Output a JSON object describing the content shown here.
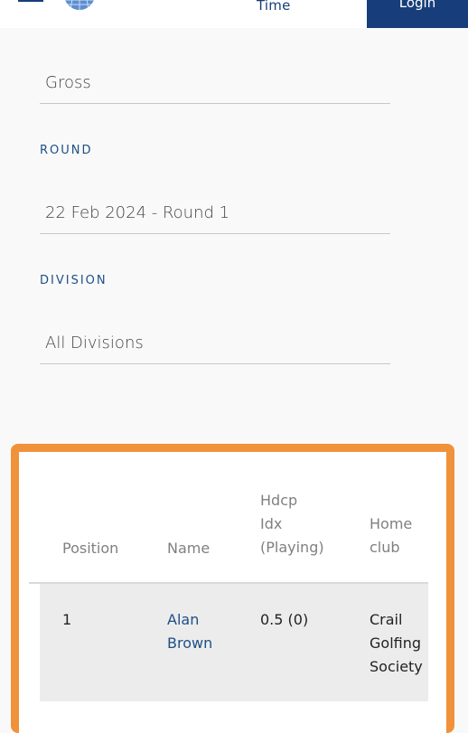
{
  "header": {
    "nav_link": "Time",
    "login_label": "Login"
  },
  "filters": {
    "score_type": {
      "value": "Gross"
    },
    "round": {
      "label": "ROUND",
      "value": "22 Feb 2024 - Round 1"
    },
    "division": {
      "label": "DIVISION",
      "value": "All Divisions"
    }
  },
  "table": {
    "columns": {
      "position": "Position",
      "name": "Name",
      "hdcp_line1": "Hdcp",
      "hdcp_line2": "Idx",
      "hdcp_line3": "(Playing)",
      "club_line1": "Home",
      "club_line2": "club"
    },
    "rows": [
      {
        "position": "1",
        "name_line1": "Alan",
        "name_line2": "Brown",
        "hdcp": "0.5 (0)",
        "club_line1": "Crail",
        "club_line2": "Golfing",
        "club_line3": "Society"
      }
    ]
  },
  "colors": {
    "brand_navy": "#173e7a",
    "highlight_orange": "#f0923a"
  },
  "icons": {
    "menu": "hamburger-menu-icon",
    "logo": "globe-logo"
  }
}
